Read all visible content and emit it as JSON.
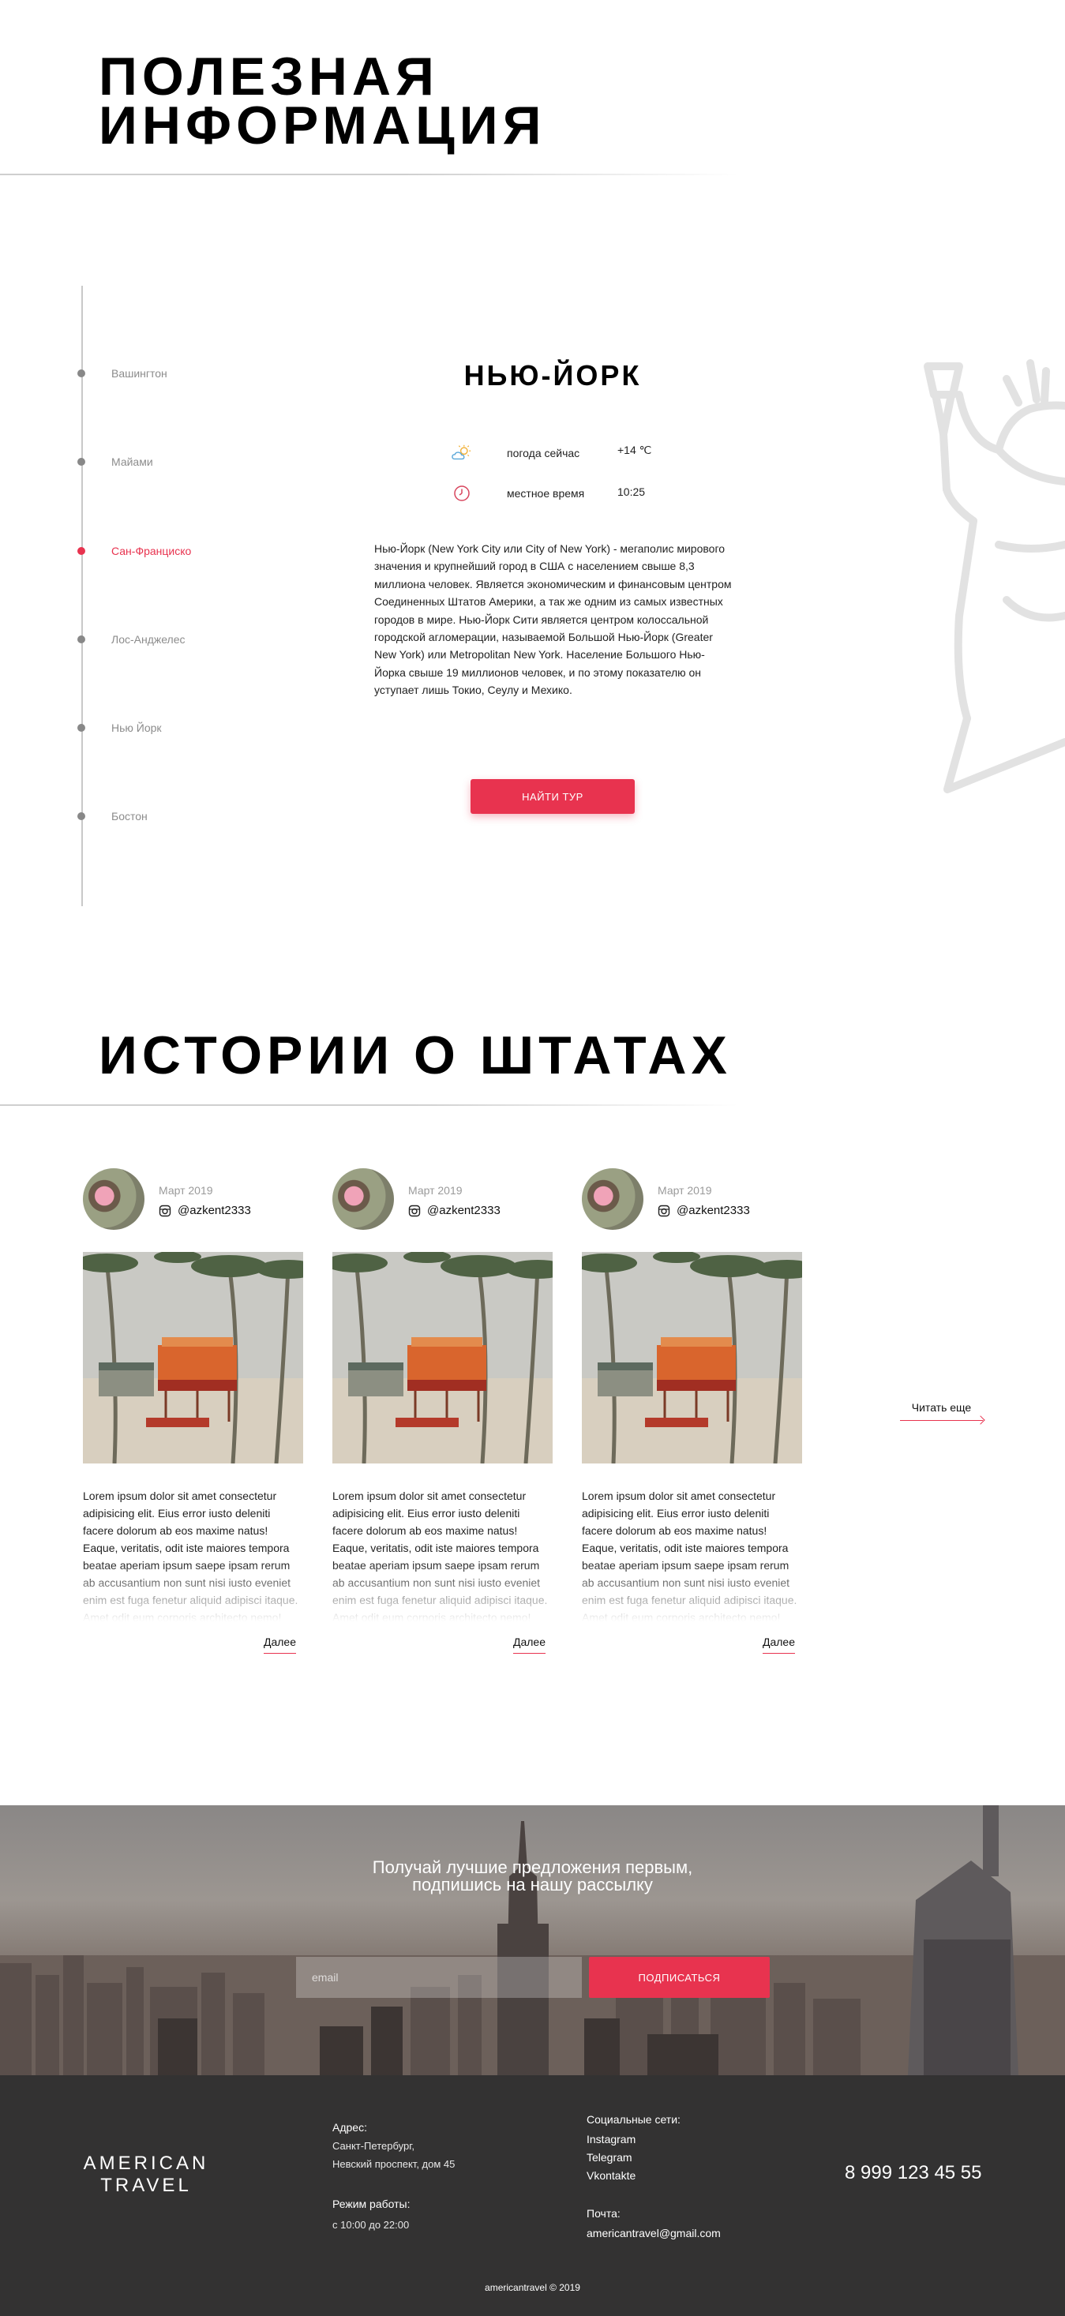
{
  "useful_info": {
    "title_line1": "ПОЛЕЗНАЯ",
    "title_line2": "ИНФОРМАЦИЯ"
  },
  "cities": [
    {
      "label": "Вашингтон",
      "active": false
    },
    {
      "label": "Майами",
      "active": false
    },
    {
      "label": "Сан-Франциско",
      "active": true
    },
    {
      "label": "Лос-Анджелес",
      "active": false
    },
    {
      "label": "Нью Йорк",
      "active": false
    },
    {
      "label": "Бостон",
      "active": false
    }
  ],
  "city_card": {
    "title": "НЬЮ-ЙОРК",
    "weather_label": "погода сейчас",
    "weather_value": "+14 ℃",
    "time_label": "местное время",
    "time_value": "10:25",
    "description": "Нью-Йорк (New York City или City of New York) - мегаполис мирового значения и крупнейший город в США с населением свыше 8,3 миллиона человек. Является экономическим и финансовым центром Соединенных Штатов Америки, а так же одним из самых известных городов в мире. Нью-Йорк Сити является центром колоссальной городской агломерации, называемой Большой Нью-Йорк (Greater New York) или Metropolitan New York. Население Большого Нью-Йорка свыше 19 миллионов человек, и по этому показателю он уступает лишь Токио, Сеулу и Мехико.",
    "button_label": "НАЙТИ ТУР"
  },
  "stories": {
    "title": "ИСТОРИИ О ШТАТАХ",
    "items": [
      {
        "date": "Март 2019",
        "user": "@azkent2333",
        "text": "Lorem ipsum dolor sit amet consectetur adipisicing elit. Eius error iusto deleniti facere dolorum ab eos maxime natus! Eaque, veritatis, odit iste maiores tempora beatae aperiam ipsum saepe ipsam rerum ab accusantium non sunt nisi iusto eveniet enim est fuga fenetur aliquid adipisci itaque. Amet odit eum corporis architecto nemo!",
        "more": "Далее"
      },
      {
        "date": "Март 2019",
        "user": "@azkent2333",
        "text": "Lorem ipsum dolor sit amet consectetur adipisicing elit. Eius error iusto deleniti facere dolorum ab eos maxime natus! Eaque, veritatis, odit iste maiores tempora beatae aperiam ipsum saepe ipsam rerum ab accusantium non sunt nisi iusto eveniet enim est fuga fenetur aliquid adipisci itaque. Amet odit eum corporis architecto nemo!",
        "more": "Далее"
      },
      {
        "date": "Март 2019",
        "user": "@azkent2333",
        "text": "Lorem ipsum dolor sit amet consectetur adipisicing elit. Eius error iusto deleniti facere dolorum ab eos maxime natus! Eaque, veritatis, odit iste maiores tempora beatae aperiam ipsum saepe ipsam rerum ab accusantium non sunt nisi iusto eveniet enim est fuga fenetur aliquid adipisci itaque. Amet odit eum corporis architecto nemo!",
        "more": "Далее"
      }
    ],
    "read_more": "Читать еще"
  },
  "subscribe": {
    "title_line1": "Получай лучшие предложения первым,",
    "title_line2": "подпишись на нашу рассылку",
    "email_placeholder": "email",
    "button_label": "ПОДПИСАТЬСЯ"
  },
  "footer": {
    "logo_line1": "AMERICAN",
    "logo_line2": "TRAVEL",
    "address_label": "Адрес:",
    "address_line1": "Санкт-Петербург,",
    "address_line2": "Невский проспект, дом 45",
    "hours_label": "Режим работы:",
    "hours_value": "с 10:00 до 22:00",
    "social_label": "Социальные сети:",
    "social_links": [
      "Instagram",
      "Telegram",
      "Vkontakte"
    ],
    "mail_label": "Почта:",
    "mail_value": "americantravel@gmail.com",
    "phone": "8 999 123 45 55",
    "copyright": "americantravel © 2019"
  },
  "colors": {
    "accent": "#e8334f",
    "footer_bg": "#333232",
    "timeline": "#c9c9c9"
  }
}
